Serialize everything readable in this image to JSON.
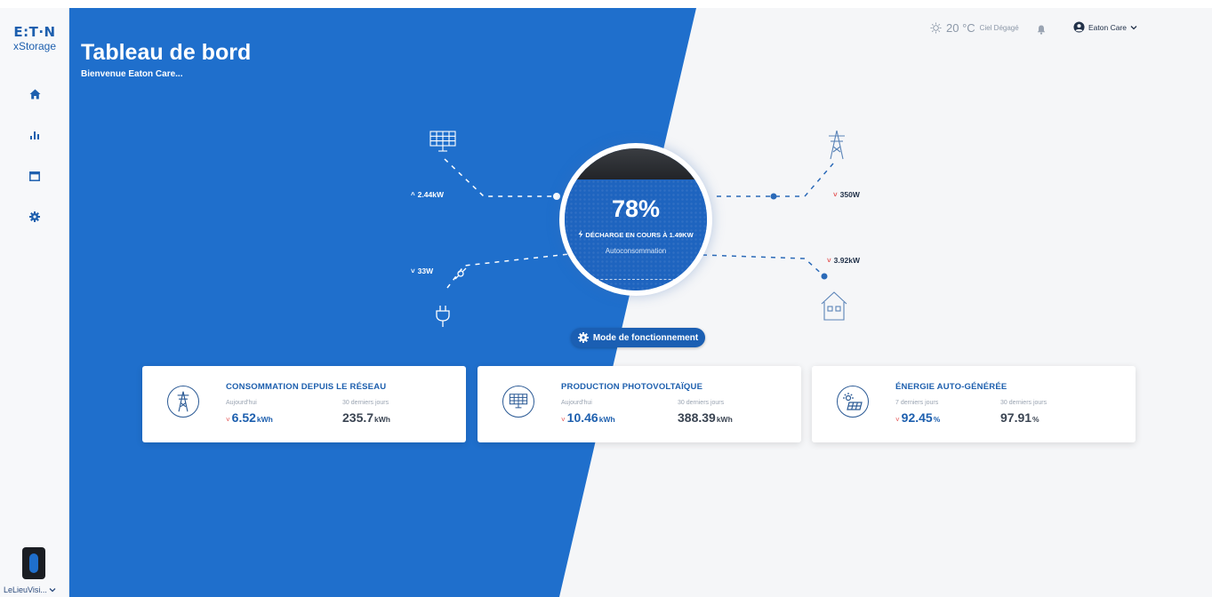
{
  "brand": {
    "logo": "E:T·N",
    "product": "xStorage"
  },
  "header": {
    "title": "Tableau de bord",
    "subtitle": "Bienvenue Eaton Care..."
  },
  "topbar": {
    "temperature": "20 °C",
    "weather": "Ciel Dégagé",
    "weather_icon": "sun-icon",
    "user": "Eaton Care"
  },
  "sidebar": {
    "items": [
      {
        "name": "home",
        "icon": "home-icon"
      },
      {
        "name": "stats",
        "icon": "bar-chart-icon"
      },
      {
        "name": "calendar",
        "icon": "calendar-icon"
      },
      {
        "name": "settings",
        "icon": "gear-icon"
      }
    ],
    "site": "LeLieuVisi..."
  },
  "battery": {
    "percent": "78%",
    "status": "DÉCHARGE EN COURS À 1.49KW",
    "mode": "Autoconsommation",
    "level": 0.78
  },
  "flows": {
    "solar": "2.44kW",
    "grid": "350W",
    "plug": "33W",
    "house": "3.92kW"
  },
  "mode_button": "Mode de fonctionnement",
  "cards": [
    {
      "title": "CONSOMMATION DEPUIS LE RÉSEAU",
      "icon": "pylon-icon",
      "left_label": "Aujourd'hui",
      "left_value": "6.52",
      "left_unit": "kWh",
      "right_label": "30 derniers jours",
      "right_value": "235.7",
      "right_unit": "kWh"
    },
    {
      "title": "PRODUCTION PHOTOVOLTAÏQUE",
      "icon": "solar-panel-icon",
      "left_label": "Aujourd'hui",
      "left_value": "10.46",
      "left_unit": "kWh",
      "right_label": "30 derniers jours",
      "right_value": "388.39",
      "right_unit": "kWh"
    },
    {
      "title": "ÉNERGIE AUTO-GÉNÉRÉE",
      "icon": "self-energy-icon",
      "left_label": "7 derniers jours",
      "left_value": "92.45",
      "left_unit": "%",
      "right_label": "30 derniers jours",
      "right_value": "97.91",
      "right_unit": "%"
    }
  ],
  "colors": {
    "primary": "#1d5fae",
    "background_blue": "#1f6fcc",
    "down_arrow": "#e35050"
  }
}
